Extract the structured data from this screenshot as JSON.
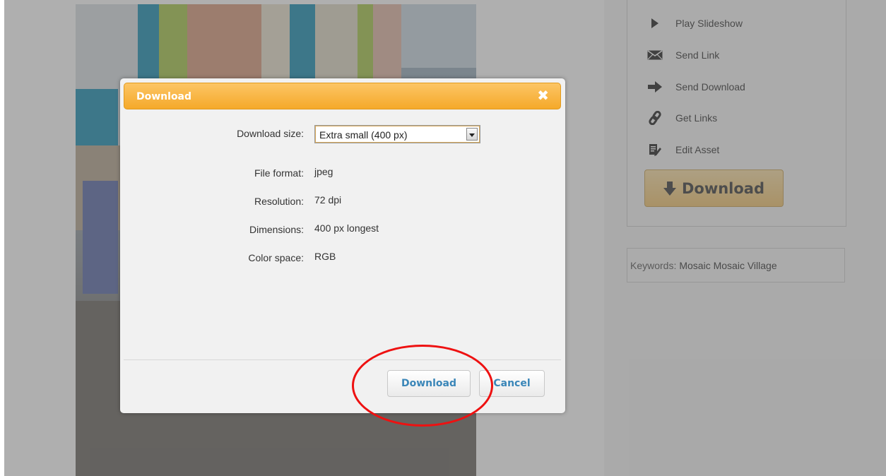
{
  "sidebar": {
    "actions": [
      {
        "label": "Play Slideshow",
        "icon": "play-icon"
      },
      {
        "label": "Send Link",
        "icon": "envelope-icon"
      },
      {
        "label": "Send Download",
        "icon": "arrow-right-icon"
      },
      {
        "label": "Get Links",
        "icon": "link-icon"
      },
      {
        "label": "Edit Asset",
        "icon": "edit-icon"
      }
    ],
    "download_button": "Download",
    "keywords_label": "Keywords:",
    "keywords_value": "Mosaic Mosaic Village"
  },
  "dialog": {
    "title": "Download",
    "close_glyph": "✖",
    "size_label": "Download size:",
    "size_value": "Extra small (400 px)",
    "fields": [
      {
        "label": "File format:",
        "value": "jpeg"
      },
      {
        "label": "Resolution:",
        "value": "72 dpi"
      },
      {
        "label": "Dimensions:",
        "value": "400 px longest"
      },
      {
        "label": "Color space:",
        "value": "RGB"
      }
    ],
    "download_button": "Download",
    "cancel_button": "Cancel"
  },
  "colors": {
    "header": "#f5a92a",
    "button_text": "#3a86b8",
    "highlight": "#ee1111",
    "download_gold": "#f2c46e"
  }
}
